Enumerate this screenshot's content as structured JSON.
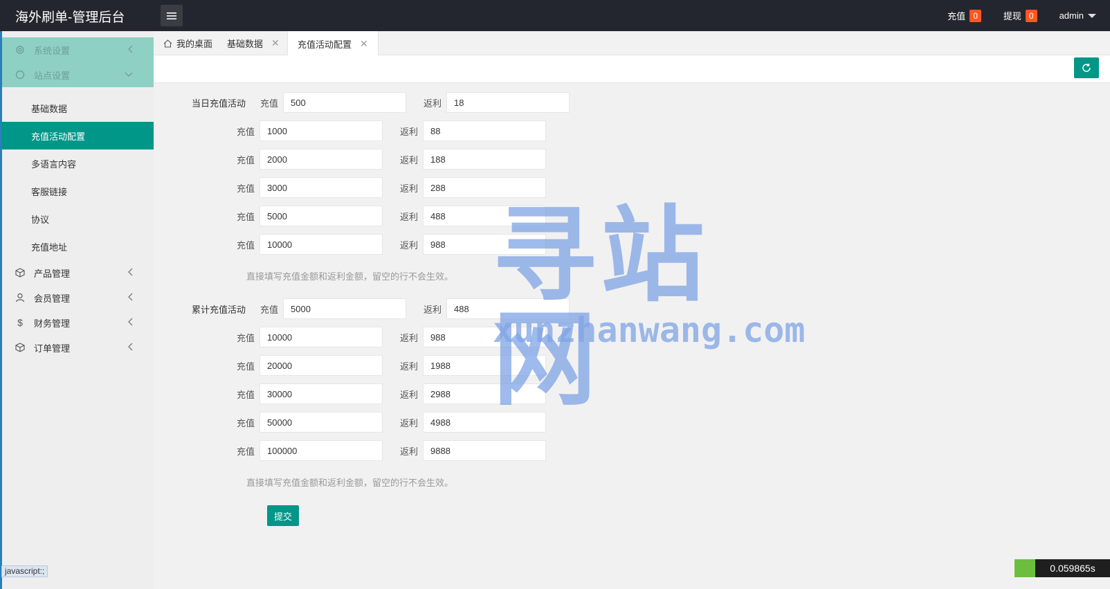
{
  "header": {
    "title": "海外刷单-管理后台",
    "recharge_label": "充值",
    "recharge_count": "0",
    "withdraw_label": "提现",
    "withdraw_count": "0",
    "user": "admin",
    "accent_color": "#009688",
    "badge_color": "#ff5722"
  },
  "sidebar": {
    "groups": [
      {
        "label": "系统设置",
        "icon": "gear-icon"
      },
      {
        "label": "站点设置",
        "icon": "site-icon"
      }
    ],
    "subitems": [
      {
        "label": "基础数据"
      },
      {
        "label": "充值活动配置"
      },
      {
        "label": "多语言内容"
      },
      {
        "label": "客服链接"
      },
      {
        "label": "协议"
      },
      {
        "label": "充值地址"
      }
    ],
    "lower_groups": [
      {
        "label": "产品管理",
        "icon": "cube-icon"
      },
      {
        "label": "会员管理",
        "icon": "user-icon"
      },
      {
        "label": "财务管理",
        "icon": "dollar-icon"
      },
      {
        "label": "订单管理",
        "icon": "cube-icon"
      }
    ]
  },
  "tabs": [
    {
      "label": "我的桌面"
    },
    {
      "label": "基础数据"
    },
    {
      "label": "充值活动配置"
    }
  ],
  "form": {
    "daily_title": "当日充值活动",
    "cumulative_title": "累计充值活动",
    "recharge_label": "充值",
    "rebate_label": "返利",
    "hint": "直接填写充值金额和返利金额，留空的行不会生效。",
    "submit": "提交",
    "daily": [
      {
        "recharge": "500",
        "rebate": "18"
      },
      {
        "recharge": "1000",
        "rebate": "88"
      },
      {
        "recharge": "2000",
        "rebate": "188"
      },
      {
        "recharge": "3000",
        "rebate": "288"
      },
      {
        "recharge": "5000",
        "rebate": "488"
      },
      {
        "recharge": "10000",
        "rebate": "988"
      }
    ],
    "cumulative": [
      {
        "recharge": "5000",
        "rebate": "488"
      },
      {
        "recharge": "10000",
        "rebate": "988"
      },
      {
        "recharge": "20000",
        "rebate": "1988"
      },
      {
        "recharge": "30000",
        "rebate": "2988"
      },
      {
        "recharge": "50000",
        "rebate": "4988"
      },
      {
        "recharge": "100000",
        "rebate": "9888"
      }
    ]
  },
  "watermark": {
    "big": "寻站网",
    "small": "xunzhanwang.com"
  },
  "status": {
    "link": "javascript:;",
    "timer": "0.059865s"
  }
}
